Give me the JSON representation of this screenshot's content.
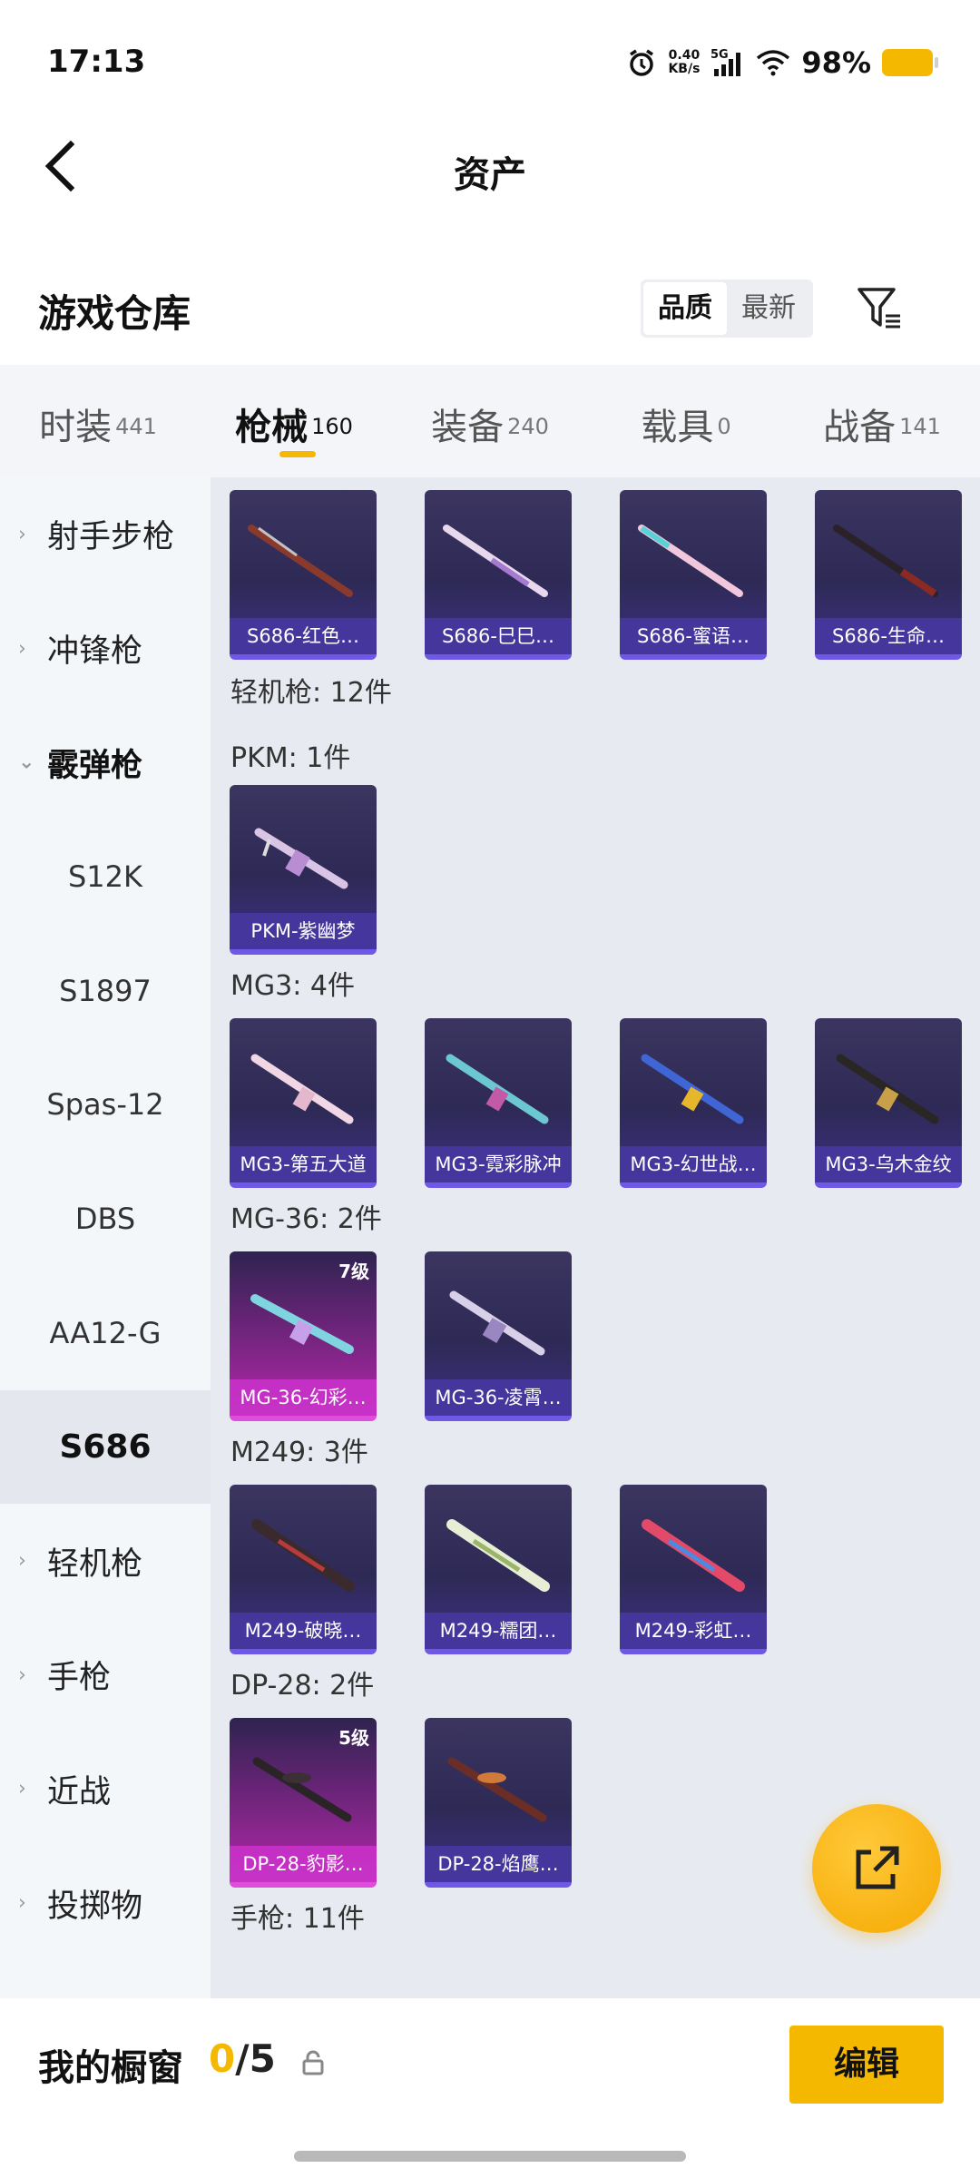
{
  "status_bar": {
    "time": "17:13",
    "net_speed_value": "0.40",
    "net_speed_unit": "KB/s",
    "network": "5G",
    "battery_percent": "98%"
  },
  "header": {
    "title": "资产"
  },
  "warehouse": {
    "title": "游戏仓库",
    "sort_options": [
      "品质",
      "最新"
    ],
    "active_sort": "品质"
  },
  "tabs": [
    {
      "label": "时装",
      "count": "441"
    },
    {
      "label": "枪械",
      "count": "160"
    },
    {
      "label": "装备",
      "count": "240"
    },
    {
      "label": "载具",
      "count": "0"
    },
    {
      "label": "战备",
      "count": "141"
    }
  ],
  "sidebar": {
    "categories": [
      {
        "label": "射手步枪"
      },
      {
        "label": "冲锋枪"
      },
      {
        "label": "霰弹枪"
      },
      {
        "label": "轻机枪"
      },
      {
        "label": "手枪"
      },
      {
        "label": "近战"
      },
      {
        "label": "投掷物"
      }
    ],
    "shotgun_subitems": [
      "S12K",
      "S1897",
      "Spas-12",
      "DBS",
      "AA12-G",
      "S686"
    ],
    "selected": "S686"
  },
  "content": {
    "top_row": [
      "S686-红色…",
      "S686-巳巳…",
      "S686-蜜语…",
      "S686-生命…"
    ],
    "group_label": "轻机枪: 12件",
    "subgroups": [
      {
        "label": "PKM: 1件",
        "items": [
          {
            "name": "PKM-紫幽梦"
          }
        ]
      },
      {
        "label": "MG3: 4件",
        "items": [
          {
            "name": "MG3-第五大道"
          },
          {
            "name": "MG3-霓彩脉冲"
          },
          {
            "name": "MG3-幻世战…"
          },
          {
            "name": "MG3-乌木金纹"
          }
        ]
      },
      {
        "label": "MG-36: 2件",
        "items": [
          {
            "name": "MG-36-幻彩…",
            "level": "7级",
            "rarity": "purple"
          },
          {
            "name": "MG-36-凌霄…"
          }
        ]
      },
      {
        "label": "M249: 3件",
        "items": [
          {
            "name": "M249-破晓…"
          },
          {
            "name": "M249-糯团…"
          },
          {
            "name": "M249-彩虹…"
          }
        ]
      },
      {
        "label": "DP-28: 2件",
        "items": [
          {
            "name": "DP-28-豹影…",
            "level": "5级",
            "rarity": "purple"
          },
          {
            "name": "DP-28-焰鹰…"
          }
        ]
      }
    ],
    "cut_label": "手枪: 11件"
  },
  "bottom_bar": {
    "showcase_label": "我的橱窗",
    "showcase_current": "0",
    "showcase_total": "/5",
    "edit_label": "编辑"
  },
  "colors": {
    "accent": "#f5b800",
    "card_blue": "#3b3560",
    "card_purple": "#c02ec0",
    "sidebar_bg": "#f4f7fa",
    "content_bg": "#e7ebf1"
  },
  "icons": {
    "back": "chevron-left-icon",
    "filter": "filter-icon",
    "share": "share-external-icon",
    "lock": "lock-icon",
    "alarm": "alarm-icon",
    "signal": "signal-icon",
    "wifi": "wifi-icon",
    "battery": "battery-icon"
  }
}
